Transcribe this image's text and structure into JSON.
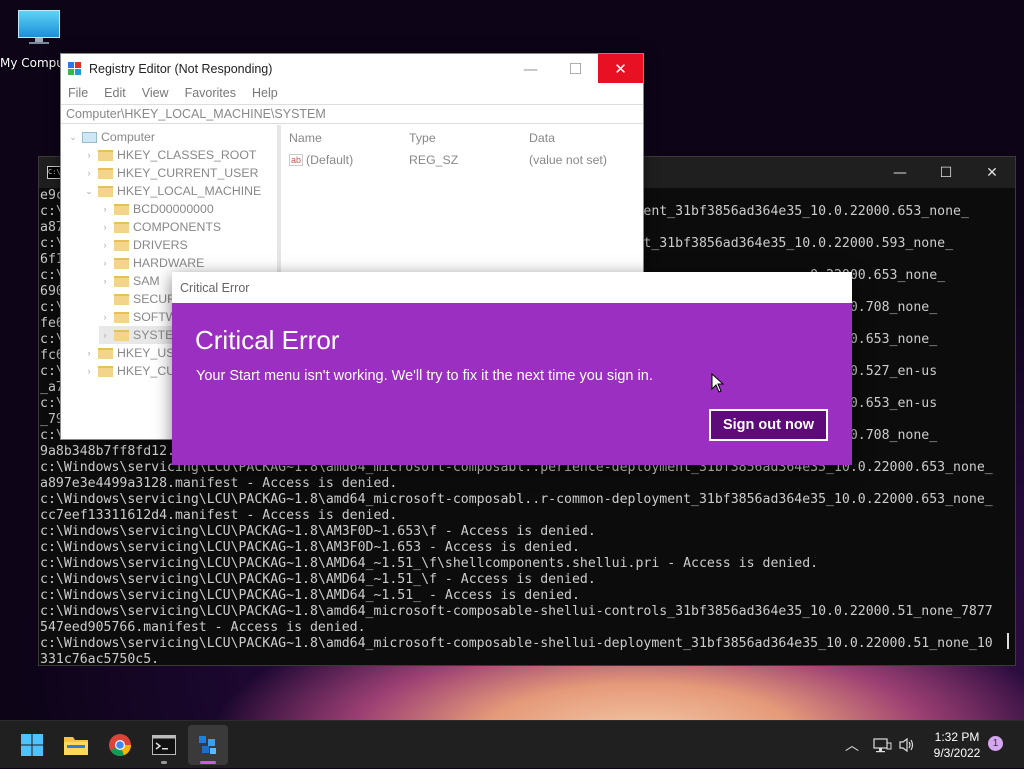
{
  "desktop": {
    "icon_label": "My Computer"
  },
  "terminal": {
    "controls": {
      "minimize": "—",
      "maximize": "☐",
      "close": "✕"
    },
    "lines": [
      "e9c",
      "c:\\                                                                    ployment_31bf3856ad364e35_10.0.22000.653_none_",
      "a87",
      "c:\\                                                                    oyment_31bf3856ad364e35_10.0.22000.593_none_",
      "6f1",
      "c:\\                                                                                             .0.22000.653_none_",
      "690",
      "c:\\                                                                                             0.22000.708_none_",
      "fe6",
      "c:\\                                                                                             0.22000.653_none_",
      "fc6",
      "c:\\                                                                                             0.22000.527_en-us",
      "_a7",
      "c:\\                                                                                             0.22000.653_en-us",
      "_79",
      "c:\\Windows\\servi                                                                                0.22000.708_none_",
      "9a8b348b7ff8fd12.",
      "c:\\Windows\\servicing\\LCU\\PACKAG~1.8\\amd64_microsoft-composabl..perience-deployment_31bf3856ad364e35_10.0.22000.653_none_",
      "a897e3e4499a3128.manifest - Access is denied.",
      "c:\\Windows\\servicing\\LCU\\PACKAG~1.8\\amd64_microsoft-composabl..r-common-deployment_31bf3856ad364e35_10.0.22000.653_none_",
      "cc7eef13311612d4.manifest - Access is denied.",
      "c:\\Windows\\servicing\\LCU\\PACKAG~1.8\\AM3F0D~1.653\\f - Access is denied.",
      "c:\\Windows\\servicing\\LCU\\PACKAG~1.8\\AM3F0D~1.653 - Access is denied.",
      "c:\\Windows\\servicing\\LCU\\PACKAG~1.8\\AMD64_~1.51_\\f\\shellcomponents.shellui.pri - Access is denied.",
      "c:\\Windows\\servicing\\LCU\\PACKAG~1.8\\AMD64_~1.51_\\f - Access is denied.",
      "c:\\Windows\\servicing\\LCU\\PACKAG~1.8\\AMD64_~1.51_ - Access is denied.",
      "c:\\Windows\\servicing\\LCU\\PACKAG~1.8\\amd64_microsoft-composable-shellui-controls_31bf3856ad364e35_10.0.22000.51_none_7877",
      "547eed905766.manifest - Access is denied.",
      "c:\\Windows\\servicing\\LCU\\PACKAG~1.8\\amd64_microsoft-composable-shellui-deployment_31bf3856ad364e35_10.0.22000.51_none_10",
      "331c76ac5750c5."
    ]
  },
  "registry": {
    "title": "Registry Editor (Not Responding)",
    "controls": {
      "minimize": "—",
      "maximize": "☐",
      "close": "✕"
    },
    "menu": [
      "File",
      "Edit",
      "View",
      "Favorites",
      "Help"
    ],
    "address": "Computer\\HKEY_LOCAL_MACHINE\\SYSTEM",
    "tree": [
      {
        "label": "Computer",
        "chev": "⌄",
        "depth": 0,
        "icon": "pc"
      },
      {
        "label": "HKEY_CLASSES_ROOT",
        "chev": "›",
        "depth": 1
      },
      {
        "label": "HKEY_CURRENT_USER",
        "chev": "›",
        "depth": 1
      },
      {
        "label": "HKEY_LOCAL_MACHINE",
        "chev": "⌄",
        "depth": 1
      },
      {
        "label": "BCD00000000",
        "chev": "›",
        "depth": 2
      },
      {
        "label": "COMPONENTS",
        "chev": "›",
        "depth": 2
      },
      {
        "label": "DRIVERS",
        "chev": "›",
        "depth": 2
      },
      {
        "label": "HARDWARE",
        "chev": "›",
        "depth": 2
      },
      {
        "label": "SAM",
        "chev": "›",
        "depth": 2
      },
      {
        "label": "SECURITY",
        "chev": "",
        "depth": 2
      },
      {
        "label": "SOFTWARE",
        "chev": "›",
        "depth": 2
      },
      {
        "label": "SYSTEM",
        "chev": "›",
        "depth": 2,
        "selected": true
      },
      {
        "label": "HKEY_USERS",
        "chev": "›",
        "depth": 1
      },
      {
        "label": "HKEY_CURRENT_CONFIG",
        "chev": "›",
        "depth": 1
      }
    ],
    "columns": [
      "Name",
      "Type",
      "Data"
    ],
    "value_row": {
      "icon": "ab",
      "name": "(Default)",
      "type": "REG_SZ",
      "data": "(value not set)"
    }
  },
  "error": {
    "window_title": "Critical Error",
    "heading": "Critical Error",
    "message": "Your Start menu isn't working. We'll try to fix it the next time you sign in.",
    "button": "Sign out now"
  },
  "taskbar": {
    "apps": [
      "windows-start",
      "file-explorer",
      "chrome",
      "terminal",
      "registry-editor"
    ],
    "time": "1:32 PM",
    "date": "9/3/2022",
    "notification_count": "1"
  },
  "colors": {
    "dialog": "#9b2fc1",
    "button": "#5e0a7a",
    "close": "#e81123",
    "taskbar": "#202020"
  }
}
